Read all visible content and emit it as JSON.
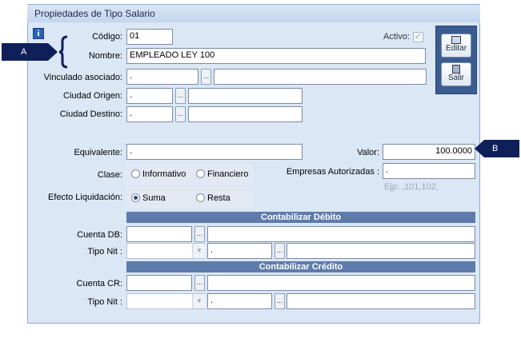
{
  "window": {
    "title": "Propiedades de Tipo Salario"
  },
  "info_icon": "info-icon",
  "fields": {
    "codigo": {
      "label": "Código:",
      "value": "01"
    },
    "activo": {
      "label": "Activo:",
      "checked": true
    },
    "nombre": {
      "label": "Nombre:",
      "value": "EMPLEADO LEY 100"
    },
    "vinculado": {
      "label": "Vinculado asociado:",
      "value": ".",
      "desc": ""
    },
    "ciudad_origen": {
      "label": "Ciudad Origen:",
      "value": ".",
      "desc": ""
    },
    "ciudad_destino": {
      "label": "Ciudad Destino:",
      "value": ".",
      "desc": ""
    },
    "equivalente": {
      "label": "Equivalente:",
      "value": "."
    },
    "valor": {
      "label": "Valor:",
      "value": "100.0000"
    },
    "clase": {
      "label": "Clase:",
      "options": [
        "Informativo",
        "Financiero"
      ],
      "selected": null
    },
    "empresas": {
      "label": "Empresas Autorizadas :",
      "value": ".",
      "hint": "Ejp: ,101,102,"
    },
    "efecto": {
      "label": "Efecto Liquidación:",
      "options": [
        "Suma",
        "Resta"
      ],
      "selected": "Suma"
    }
  },
  "debito": {
    "header": "Contabilizar Débito",
    "cuenta_label": "Cuenta DB:",
    "tipo_nit_label": "Tipo Nit :",
    "tipo_nit_value": ".",
    "cuenta_value": "",
    "cuenta_desc": "",
    "tipo_nit_desc": ""
  },
  "credito": {
    "header": "Contabilizar Crédito",
    "cuenta_label": "Cuenta CR:",
    "tipo_nit_label": "Tipo Nit :",
    "tipo_nit_value": ".",
    "cuenta_value": "",
    "cuenta_desc": "",
    "tipo_nit_desc": ""
  },
  "buttons": {
    "editar": "Editar",
    "salir": "Salir",
    "browse": "..."
  },
  "callouts": {
    "a": "A",
    "b": "B"
  },
  "colors": {
    "accent": "#0f1f5a",
    "section": "#5f7bab",
    "window": "#dbe7f5"
  }
}
